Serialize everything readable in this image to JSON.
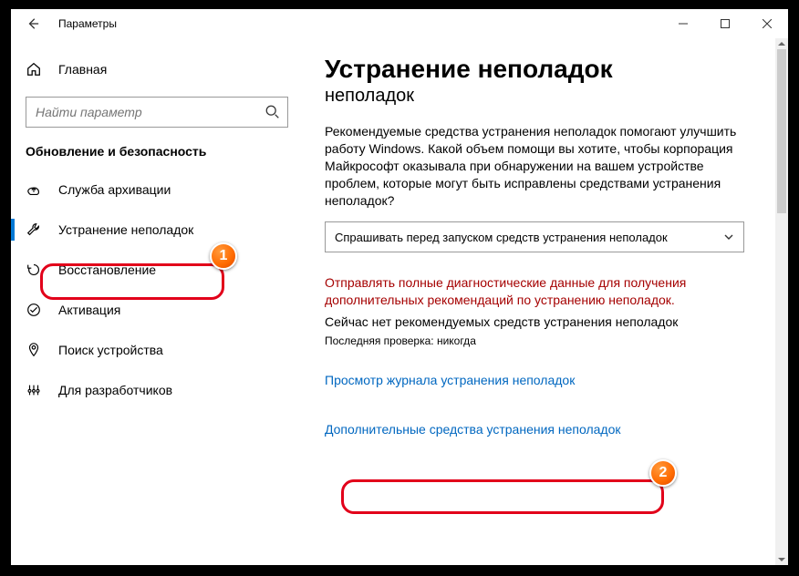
{
  "window": {
    "title": "Параметры"
  },
  "sidebar": {
    "home": "Главная",
    "search_placeholder": "Найти параметр",
    "section": "Обновление и безопасность",
    "items": [
      {
        "label": "Служба архивации"
      },
      {
        "label": "Устранение неполадок"
      },
      {
        "label": "Восстановление"
      },
      {
        "label": "Активация"
      },
      {
        "label": "Поиск устройства"
      },
      {
        "label": "Для разработчиков"
      }
    ]
  },
  "main": {
    "title": "Устранение неполадок",
    "subtitle": "неполадок",
    "body": "Рекомендуемые средства устранения неполадок помогают улучшить работу Windows. Какой объем помощи вы хотите, чтобы корпорация Майкрософт оказывала при обнаружении на вашем устройстве проблем, которые могут быть исправлены средствами устранения неполадок?",
    "combo_value": "Спрашивать перед запуском средств устранения неполадок",
    "warning": "Отправлять полные диагностические данные для получения дополнительных рекомендаций по устранению неполадок.",
    "no_rec": "Сейчас нет рекомендуемых средств устранения неполадок",
    "last_check": "Последняя проверка: никогда",
    "link_history": "Просмотр журнала устранения неполадок",
    "link_more": "Дополнительные средства устранения неполадок"
  },
  "callouts": {
    "one": "1",
    "two": "2"
  }
}
